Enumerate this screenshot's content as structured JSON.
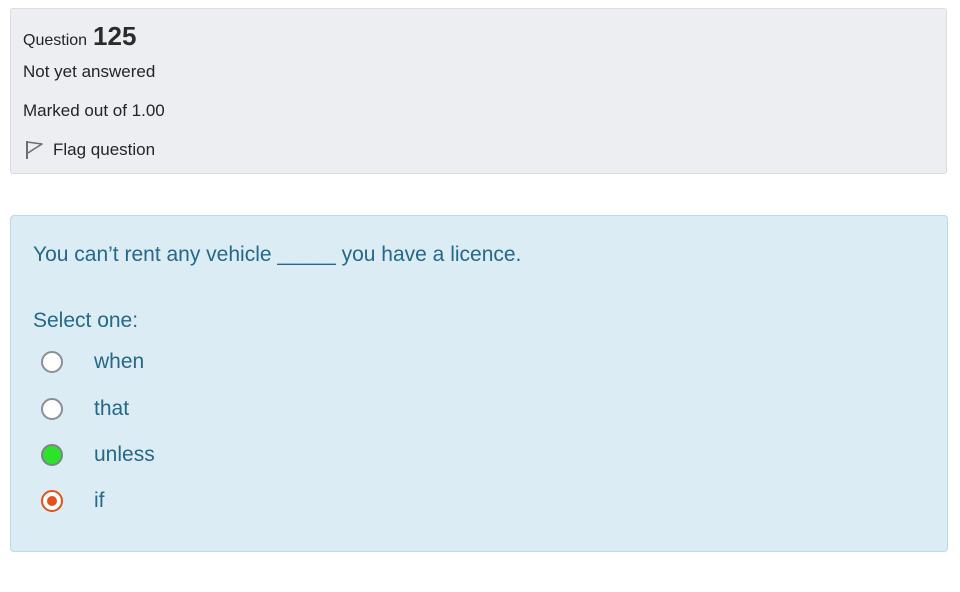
{
  "info": {
    "question_prefix": "Question",
    "question_number": "125",
    "status": "Not yet answered",
    "marks": "Marked out of 1.00",
    "flag_label": "Flag question"
  },
  "question": {
    "text": "You can’t rent any vehicle _____ you have a licence.",
    "select_label": "Select one:",
    "options": [
      {
        "label": "when",
        "state": "unselected"
      },
      {
        "label": "that",
        "state": "unselected"
      },
      {
        "label": "unless",
        "state": "correct"
      },
      {
        "label": "if",
        "state": "selected"
      }
    ]
  },
  "colors": {
    "info_bg": "#eceef1",
    "question_bg": "#dbecf5",
    "text_blue": "#256888",
    "correct_fill": "#2de32a",
    "selected_ring": "#e0531b"
  }
}
